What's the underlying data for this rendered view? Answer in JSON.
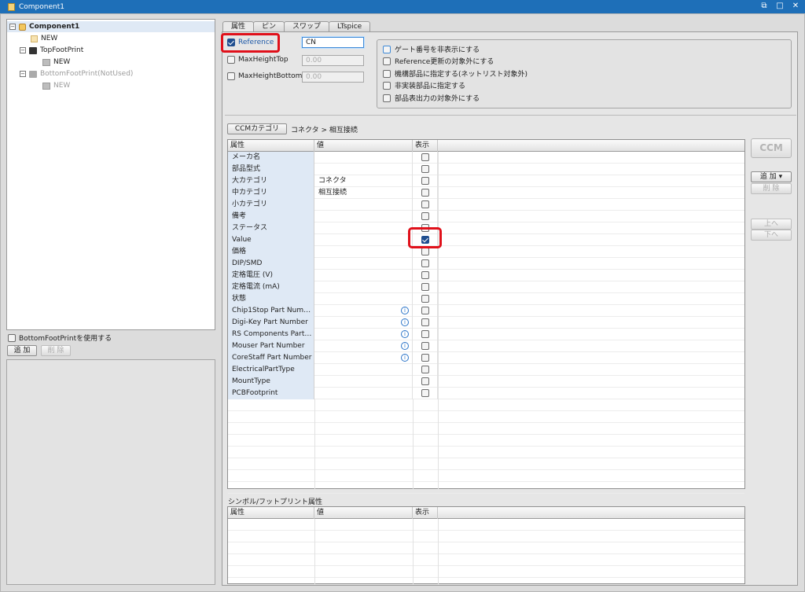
{
  "window": {
    "title": "Component1",
    "buttons": [
      "restore-icon",
      "maximize-icon",
      "close-icon"
    ]
  },
  "tree": {
    "nodes": [
      {
        "label": "Component1",
        "bold": true
      },
      {
        "label": "NEW"
      },
      {
        "label": "TopFootPrint"
      },
      {
        "label": "NEW"
      },
      {
        "label": "BottomFootPrint(NotUsed)"
      },
      {
        "label": "NEW"
      }
    ]
  },
  "left": {
    "use_bottom_label": "BottomFootPrintを使用する",
    "add_label": "追 加",
    "delete_label": "削 除"
  },
  "tabs": [
    "属性",
    "ピン",
    "スワップ",
    "LTspice"
  ],
  "reference": {
    "label": "Reference",
    "checked": true,
    "value": "CN"
  },
  "maxheight_top": {
    "label": "MaxHeightTop",
    "value": "0.00"
  },
  "maxheight_bottom": {
    "label": "MaxHeightBottom",
    "value": "0.00"
  },
  "options": [
    "ゲート番号を非表示にする",
    "Reference更新の対象外にする",
    "機構部品に指定する(ネットリスト対象外)",
    "非実装部品に指定する",
    "部品表出力の対象外にする"
  ],
  "ccm_category_label": "CCMカテゴリ",
  "category_path": "コネクタ > 相互接続",
  "grid_headers": [
    "属性",
    "値",
    "表示"
  ],
  "rows": [
    {
      "name": "メーカ名",
      "value": "",
      "info": false,
      "checked": false
    },
    {
      "name": "部品型式",
      "value": "",
      "info": false,
      "checked": false
    },
    {
      "name": "大カテゴリ",
      "value": "コネクタ",
      "info": false,
      "checked": false
    },
    {
      "name": "中カテゴリ",
      "value": "相互接続",
      "info": false,
      "checked": false
    },
    {
      "name": "小カテゴリ",
      "value": "",
      "info": false,
      "checked": false
    },
    {
      "name": "備考",
      "value": "",
      "info": false,
      "checked": false
    },
    {
      "name": "ステータス",
      "value": "",
      "info": false,
      "checked": false
    },
    {
      "name": "Value",
      "value": "",
      "info": false,
      "checked": true
    },
    {
      "name": "価格",
      "value": "",
      "info": false,
      "checked": false
    },
    {
      "name": "DIP/SMD",
      "value": "",
      "info": false,
      "checked": false
    },
    {
      "name": "定格電圧 (V)",
      "value": "",
      "info": false,
      "checked": false
    },
    {
      "name": "定格電流 (mA)",
      "value": "",
      "info": false,
      "checked": false
    },
    {
      "name": "状態",
      "value": "",
      "info": false,
      "checked": false
    },
    {
      "name": "Chip1Stop Part Num…",
      "value": "",
      "info": true,
      "checked": false
    },
    {
      "name": "Digi-Key Part Number",
      "value": "",
      "info": true,
      "checked": false
    },
    {
      "name": "RS Components Part…",
      "value": "",
      "info": true,
      "checked": false
    },
    {
      "name": "Mouser Part Number",
      "value": "",
      "info": true,
      "checked": false
    },
    {
      "name": "CoreStaff Part Number",
      "value": "",
      "info": true,
      "checked": false
    },
    {
      "name": "ElectricalPartType",
      "value": "",
      "info": false,
      "checked": false
    },
    {
      "name": "MountType",
      "value": "",
      "info": false,
      "checked": false
    },
    {
      "name": "PCBFootprint",
      "value": "",
      "info": false,
      "checked": false
    }
  ],
  "side": {
    "ccm_label": "CCM",
    "add_label": "追 加 ▾",
    "delete_label": "削 除",
    "up_label": "上へ",
    "down_label": "下へ"
  },
  "symbol_section_label": "シンボル/フットプリント属性",
  "symbol_grid_headers": [
    "属性",
    "値",
    "表示"
  ],
  "colors": {
    "titlebar": "#1e6fb8",
    "highlight": "#e0101a",
    "checkbox_on": "#1f4e8f"
  }
}
